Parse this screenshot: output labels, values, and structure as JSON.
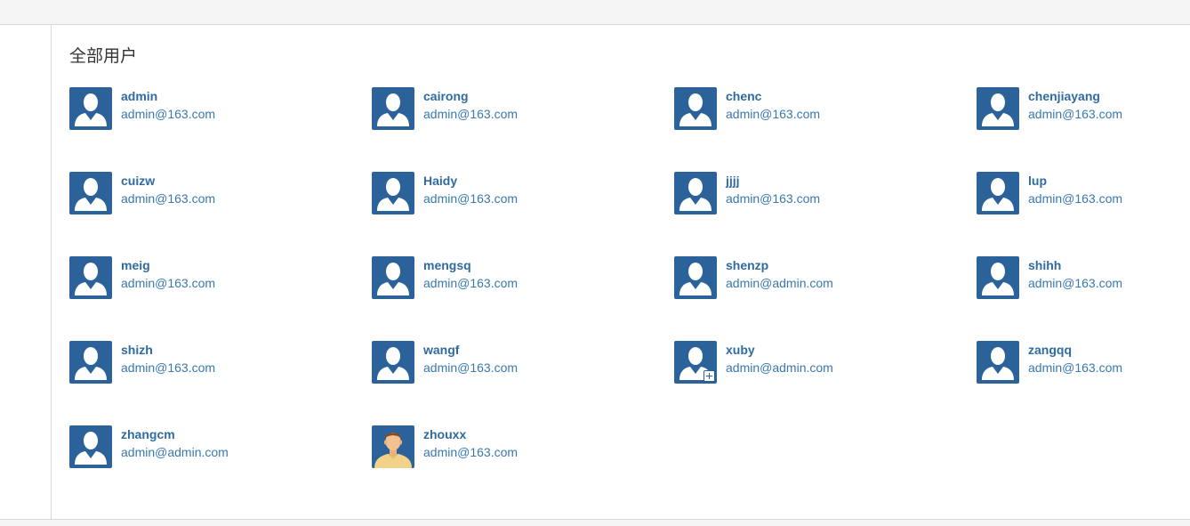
{
  "page": {
    "title": "全部用户"
  },
  "colors": {
    "avatar_bg": "#2b6299",
    "name": "#2f6ba0",
    "email": "#3a78b0"
  },
  "users": [
    {
      "name": "admin",
      "email": "admin@163.com",
      "avatar": "default-user-icon"
    },
    {
      "name": "cairong",
      "email": "admin@163.com",
      "avatar": "default-user-icon"
    },
    {
      "name": "chenc",
      "email": "admin@163.com",
      "avatar": "default-user-icon"
    },
    {
      "name": "chenjiayang",
      "email": "admin@163.com",
      "avatar": "default-user-icon"
    },
    {
      "name": "cuizw",
      "email": "admin@163.com",
      "avatar": "default-user-icon"
    },
    {
      "name": "Haidy",
      "email": "admin@163.com",
      "avatar": "default-user-icon"
    },
    {
      "name": "jjjj",
      "email": "admin@163.com",
      "avatar": "default-user-icon"
    },
    {
      "name": "lup",
      "email": "admin@163.com",
      "avatar": "default-user-icon"
    },
    {
      "name": "meig",
      "email": "admin@163.com",
      "avatar": "default-user-icon"
    },
    {
      "name": "mengsq",
      "email": "admin@163.com",
      "avatar": "default-user-icon"
    },
    {
      "name": "shenzp",
      "email": "admin@admin.com",
      "avatar": "default-user-icon"
    },
    {
      "name": "shihh",
      "email": "admin@163.com",
      "avatar": "default-user-icon"
    },
    {
      "name": "shizh",
      "email": "admin@163.com",
      "avatar": "default-user-icon"
    },
    {
      "name": "wangf",
      "email": "admin@163.com",
      "avatar": "default-user-icon"
    },
    {
      "name": "xuby",
      "email": "admin@admin.com",
      "avatar": "add-user-icon"
    },
    {
      "name": "zangqq",
      "email": "admin@163.com",
      "avatar": "default-user-icon"
    },
    {
      "name": "zhangcm",
      "email": "admin@admin.com",
      "avatar": "default-user-icon"
    },
    {
      "name": "zhouxx",
      "email": "admin@163.com",
      "avatar": "photo-avatar-icon"
    }
  ]
}
